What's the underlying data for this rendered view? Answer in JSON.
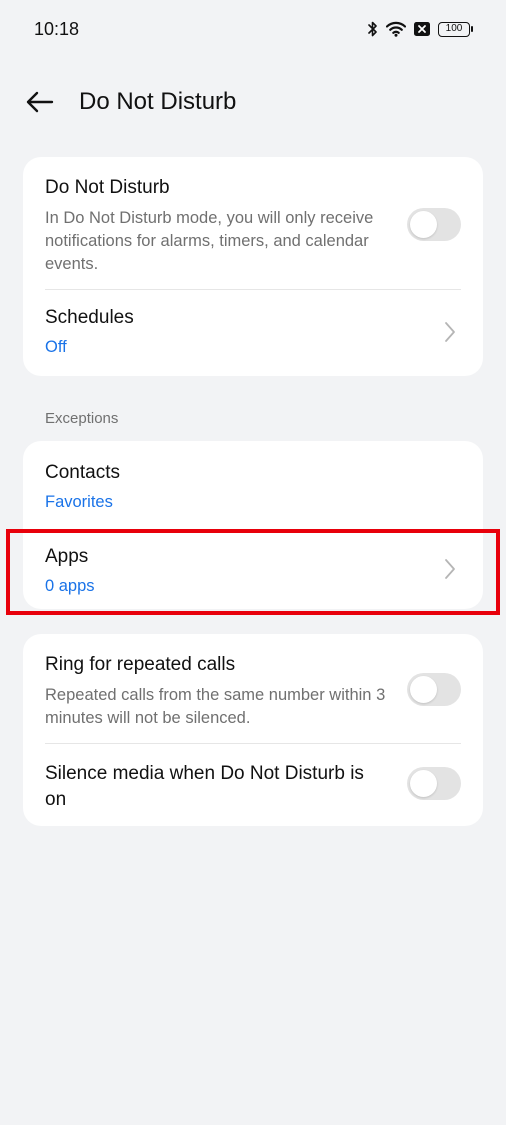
{
  "status_bar": {
    "time": "10:18",
    "battery": "100",
    "icons": [
      "bluetooth-icon",
      "wifi-icon",
      "no-sim-icon",
      "battery-icon"
    ]
  },
  "header": {
    "title": "Do Not Disturb",
    "back_icon": "back-arrow-icon"
  },
  "dnd_card": {
    "dnd": {
      "title": "Do Not Disturb",
      "description": "In Do Not Disturb mode, you will only receive notifications for alarms, timers, and calendar events.",
      "enabled": false
    },
    "schedules": {
      "title": "Schedules",
      "value": "Off"
    }
  },
  "exceptions": {
    "label": "Exceptions",
    "contacts": {
      "title": "Contacts",
      "value": "Favorites"
    },
    "apps": {
      "title": "Apps",
      "value": "0 apps"
    }
  },
  "calls_card": {
    "repeated_calls": {
      "title": "Ring for repeated calls",
      "description": "Repeated calls from the same number within 3 minutes will not be silenced.",
      "enabled": false
    },
    "silence_media": {
      "title": "Silence media when Do Not Disturb is on",
      "enabled": false
    }
  },
  "colors": {
    "background": "#f2f3f5",
    "card": "#ffffff",
    "accent": "#1a73e8",
    "secondary_text": "#707070",
    "highlight": "#e8000b"
  }
}
